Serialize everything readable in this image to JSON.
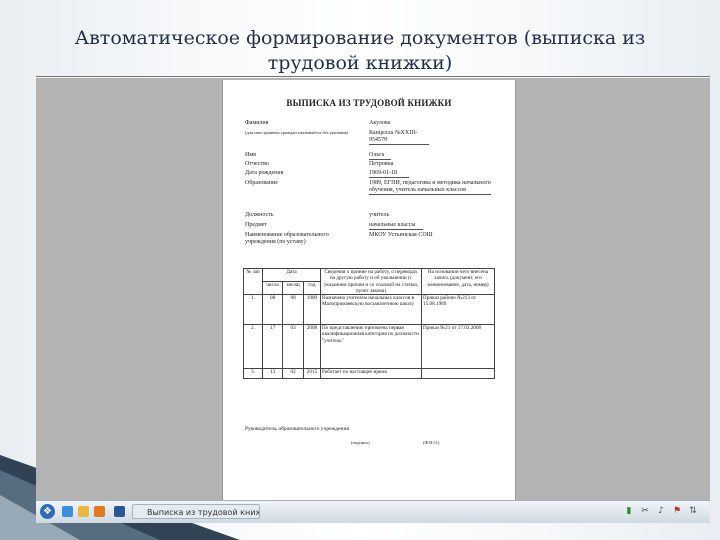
{
  "slide": {
    "title": "Автоматическое формирование документов (выписка из трудовой книжки)"
  },
  "document": {
    "heading": "ВЫПИСКА ИЗ ТРУДОВОЙ КНИЖКИ",
    "fields": [
      {
        "label": "Фамилия",
        "value": "Акулова"
      },
      {
        "label": "(для иностранных граждан указывается без указания)",
        "value": "Канцелла №XXIII-954579"
      },
      {
        "label": "Имя",
        "value": "Ольга"
      },
      {
        "label": "Отчество",
        "value": "Петровна"
      },
      {
        "label": "Дата рождения",
        "value": "1969-01-18"
      },
      {
        "label": "Образование",
        "value": "1989, ЕГПИ, педагогика и методика начального обучения, учитель начальных классов"
      },
      {
        "label": "Должность",
        "value": "учитель"
      },
      {
        "label": "Предмет",
        "value": "начальные классы"
      },
      {
        "label": "Наименование образовательного учреждения (по уставу)",
        "value": "МКОУ Устьинская СОШ"
      }
    ],
    "table": {
      "headers": {
        "num": "№ зап",
        "date": "Дата",
        "day": "число",
        "month": "месяц",
        "year": "год",
        "info": "Сведения о приеме на работу, о переводах на другую работу и об увольнении (с указанием причин и со ссылкой на статью, пункт закона)",
        "basis": "На основании чего внесена запись (документ, его наименование, дата, номер)"
      },
      "rows": [
        {
          "num": "1.",
          "day": "08",
          "month": "08",
          "year": "1989",
          "info": "Назначена учителем начальных классов в Малопримаевскую восьмилетнюю школу",
          "basis": "Приказ районо №213 от 15.08.1989"
        },
        {
          "num": "2.",
          "day": "17",
          "month": "03",
          "year": "2008",
          "info": "По представлению присвоена первая квалификационная категория по должности \"учитель\"",
          "basis": "Приказ №21 от 17.03.2008"
        },
        {
          "num": "3.",
          "day": "13",
          "month": "02",
          "year": "2015",
          "info": "Работает по настоящее время",
          "basis": ""
        }
      ]
    },
    "footer": {
      "head_label": "Руководитель образовательного учреждения",
      "sign_label": "(подпись)",
      "fio_label": "(Ф.И.О.)"
    }
  },
  "taskbar": {
    "window_label": "Выписка из трудовой книжки",
    "icons": [
      "start-orb-icon",
      "ie-icon",
      "folder-icon",
      "media-player-icon",
      "word-icon"
    ],
    "tray": [
      "network-icon",
      "scissors-icon",
      "volume-icon",
      "flag-icon",
      "arrows-icon"
    ]
  },
  "colors": {
    "title": "#23304a",
    "taskbar": "#cfd9e3",
    "wedge": "#1f3346"
  }
}
